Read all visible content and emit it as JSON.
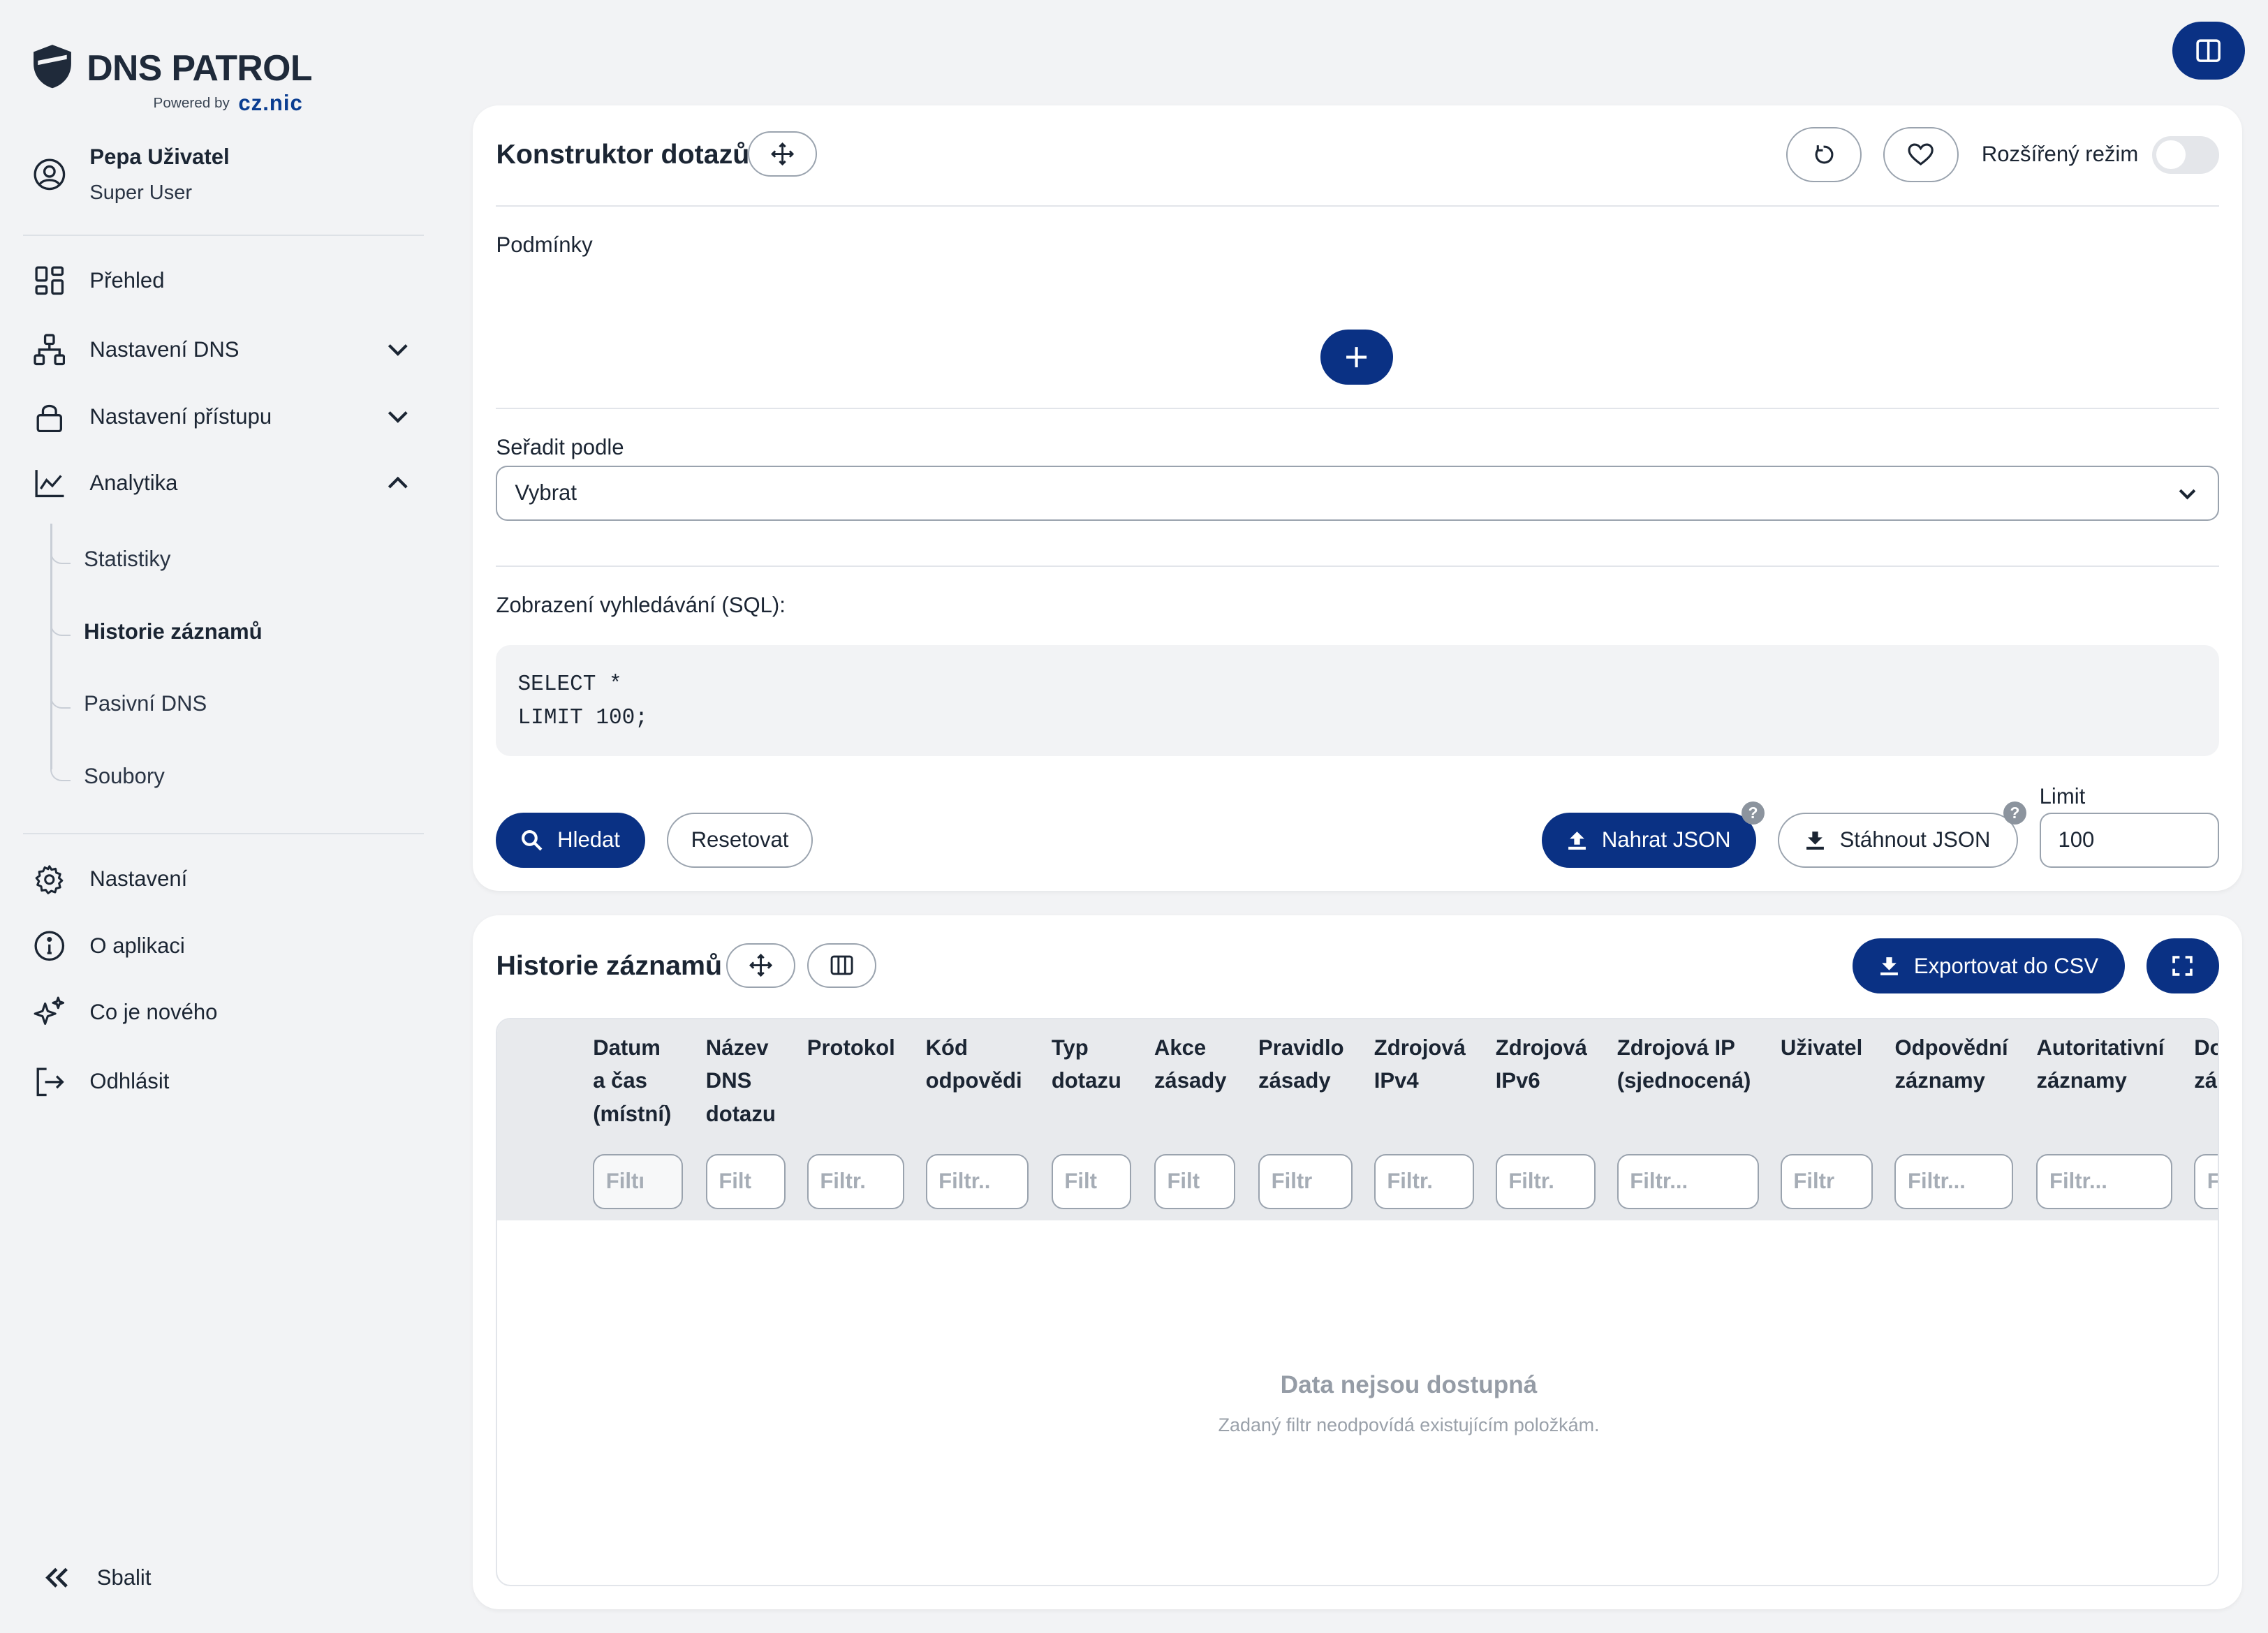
{
  "brand": {
    "name": "DNS PATROL",
    "powered_by": "Powered by",
    "partner": "cz.nic"
  },
  "user": {
    "name": "Pepa Uživatel",
    "role": "Super User"
  },
  "nav": {
    "overview": "Přehled",
    "dns_settings": "Nastavení DNS",
    "access_settings": "Nastavení přístupu",
    "analytics": "Analytika",
    "analytics_sub": [
      "Statistiky",
      "Historie záznamů",
      "Pasivní DNS",
      "Soubory"
    ],
    "settings": "Nastavení",
    "about": "O aplikaci",
    "whats_new": "Co je nového",
    "logout": "Odhlásit",
    "collapse": "Sbalit"
  },
  "query_builder": {
    "title": "Konstruktor dotazů",
    "advanced_mode": "Rozšířený režim",
    "conditions": "Podmínky",
    "sort_by": "Seřadit podle",
    "sort_value": "Vybrat",
    "sql_label": "Zobrazení vyhledávání (SQL):",
    "sql": "SELECT *\nLIMIT 100;",
    "search": "Hledat",
    "reset": "Resetovat",
    "upload_json": "Nahrat JSON",
    "download_json": "Stáhnout JSON",
    "limit_label": "Limit",
    "limit_value": "100",
    "help": "?"
  },
  "history": {
    "title": "Historie záznamů",
    "export_csv": "Exportovat do CSV",
    "columns": [
      {
        "l1": "Datum",
        "l2": "a čas",
        "l3": "(místní)",
        "filter": "Filtı"
      },
      {
        "l1": "Název",
        "l2": "DNS",
        "l3": "dotazu",
        "filter": "Filt"
      },
      {
        "l1": "Protokol",
        "l2": "",
        "l3": "",
        "filter": "Filtr."
      },
      {
        "l1": "Kód",
        "l2": "odpovědi",
        "l3": "",
        "filter": "Filtr.."
      },
      {
        "l1": "Typ",
        "l2": "dotazu",
        "l3": "",
        "filter": "Filt"
      },
      {
        "l1": "Akce",
        "l2": "zásady",
        "l3": "",
        "filter": "Filt"
      },
      {
        "l1": "Pravidlo",
        "l2": "zásady",
        "l3": "",
        "filter": "Filtr"
      },
      {
        "l1": "Zdrojová",
        "l2": "IPv4",
        "l3": "",
        "filter": "Filtr."
      },
      {
        "l1": "Zdrojová",
        "l2": "IPv6",
        "l3": "",
        "filter": "Filtr."
      },
      {
        "l1": "Zdrojová IP",
        "l2": "(sjednocená)",
        "l3": "",
        "filter": "Filtr..."
      },
      {
        "l1": "Uživatel",
        "l2": "",
        "l3": "",
        "filter": "Filtr"
      },
      {
        "l1": "Odpovědní",
        "l2": "záznamy",
        "l3": "",
        "filter": "Filtr..."
      },
      {
        "l1": "Autoritativní",
        "l2": "záznamy",
        "l3": "",
        "filter": "Filtr..."
      },
      {
        "l1": "Do",
        "l2": "zá",
        "l3": "",
        "filter": "F"
      }
    ],
    "empty_title": "Data nejsou dostupná",
    "empty_subtitle": "Zadaný filtr neodpovídá existujícím položkám."
  },
  "colors": {
    "primary": "#0a3184",
    "background": "#f2f3f5",
    "card": "#ffffff"
  }
}
